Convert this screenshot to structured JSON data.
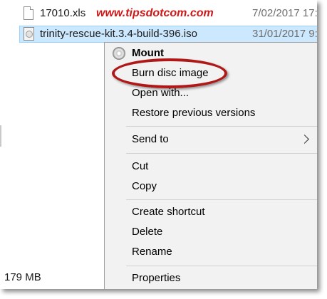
{
  "watermark": "www.tipsdotcom.com",
  "files": [
    {
      "name": "17010.xls",
      "date": "7/02/2017 17:",
      "icon": "document-icon"
    },
    {
      "name": "trinity-rescue-kit.3.4-build-396.iso",
      "date": "31/01/2017 9:",
      "icon": "disc-image-icon"
    }
  ],
  "status": {
    "size": "179 MB"
  },
  "context_menu": {
    "mount": "Mount",
    "burn": "Burn disc image",
    "open_with": "Open with...",
    "restore": "Restore previous versions",
    "send_to": "Send to",
    "cut": "Cut",
    "copy": "Copy",
    "create_shortcut": "Create shortcut",
    "delete": "Delete",
    "rename": "Rename",
    "properties": "Properties"
  },
  "colors": {
    "selection": "#cce8ff",
    "selection_border": "#99d1ff",
    "watermark": "#d01818",
    "annotation_ellipse": "#b01818",
    "menu_background": "#f2f2f2"
  }
}
